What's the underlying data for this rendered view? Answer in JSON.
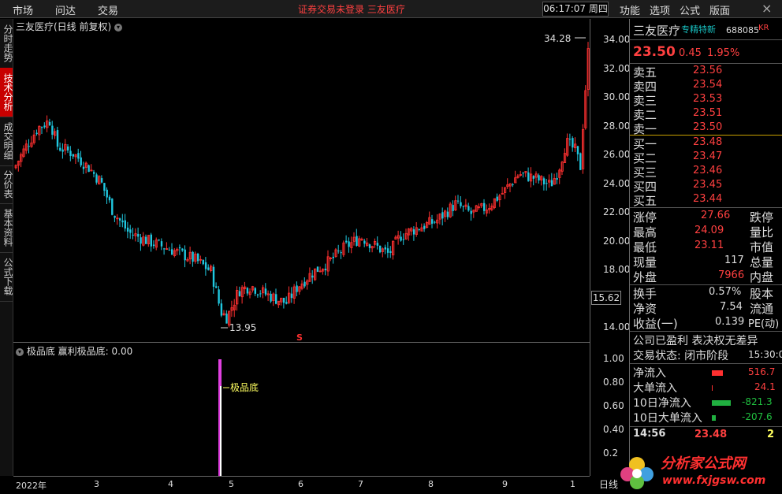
{
  "topbar": {
    "nav": [
      "市场",
      "问达",
      "交易"
    ],
    "notice_login": "证券交易未登录",
    "notice_stock": "三友医疗",
    "clock": "06:17:07 周四",
    "menu": [
      "功能",
      "选项",
      "公式",
      "版面"
    ],
    "close": "×"
  },
  "left_tabs": [
    {
      "label": "分时走势",
      "active": false
    },
    {
      "label": "技术分析",
      "active": true
    },
    {
      "label": "成交明细",
      "active": false
    },
    {
      "label": "分价表",
      "active": false
    },
    {
      "label": "基本资料",
      "active": false
    },
    {
      "label": "公式下载",
      "active": false
    }
  ],
  "main_chart": {
    "title": "三友医疗(日线 前复权)",
    "high_label": "34.28",
    "low_label": "13.95",
    "current_price_box": "15.62",
    "marker": "S",
    "y_labels": [
      "34.00",
      "32.00",
      "30.00",
      "28.00",
      "26.00",
      "24.00",
      "22.00",
      "20.00",
      "18.00",
      "14.00"
    ]
  },
  "sub_chart": {
    "title": "极品底",
    "indicator": "赢利极品底: 0.00",
    "annotation": "极品底",
    "y_labels": [
      "1.00",
      "0.80",
      "0.60",
      "0.40",
      "0.2"
    ]
  },
  "x_axis": {
    "labels": [
      "2022年",
      "3",
      "4",
      "5",
      "6",
      "7",
      "8",
      "9",
      "1"
    ],
    "day_button": "日线"
  },
  "quote": {
    "name": "三友医疗",
    "tag": "专精特新",
    "code": "688085",
    "kr": "KR",
    "price": "23.50",
    "change": "0.45",
    "change_pct": "1.95%",
    "asks": [
      {
        "label": "卖五",
        "price": "23.56"
      },
      {
        "label": "卖四",
        "price": "23.54"
      },
      {
        "label": "卖三",
        "price": "23.53"
      },
      {
        "label": "卖二",
        "price": "23.51"
      },
      {
        "label": "卖一",
        "price": "23.50"
      }
    ],
    "bids": [
      {
        "label": "买一",
        "price": "23.48"
      },
      {
        "label": "买二",
        "price": "23.47"
      },
      {
        "label": "买三",
        "price": "23.46"
      },
      {
        "label": "买四",
        "price": "23.45"
      },
      {
        "label": "买五",
        "price": "23.44"
      }
    ],
    "stats": [
      {
        "l1": "涨停",
        "v": "27.66",
        "l2": "跌停"
      },
      {
        "l1": "最高",
        "v": "24.09",
        "l2": "量比"
      },
      {
        "l1": "最低",
        "v": "23.11",
        "l2": "市值"
      },
      {
        "l1": "现量",
        "v": "117",
        "l2": "总量"
      },
      {
        "l1": "外盘",
        "v": "7966",
        "l2": "内盘"
      }
    ],
    "stats2": [
      {
        "l1": "换手",
        "v": "0.57%",
        "l2": "股本"
      },
      {
        "l1": "净资",
        "v": "7.54",
        "l2": "流通"
      },
      {
        "l1": "收益(一)",
        "v": "0.139",
        "l2": "PE(动)"
      }
    ],
    "company_note": "公司已盈利 表决权无差异",
    "status": "交易状态: 闭市阶段",
    "status_time": "15:30:0",
    "flows": [
      {
        "label": "净流入",
        "value": "516.7"
      },
      {
        "label": "大单流入",
        "value": "24.1"
      },
      {
        "label": "10日净流入",
        "value": "-821.3"
      },
      {
        "label": "10日大单流入",
        "value": "-207.6"
      }
    ],
    "tick": {
      "time": "14:56",
      "price": "23.48",
      "vol": "2"
    }
  },
  "watermark": {
    "text": "分析家公式网",
    "url": "www.fxjgsw.com"
  },
  "colors": {
    "up": "#ff3030",
    "down": "#20c8e0",
    "magenta": "#e040e0",
    "yellow": "#ffff60"
  }
}
